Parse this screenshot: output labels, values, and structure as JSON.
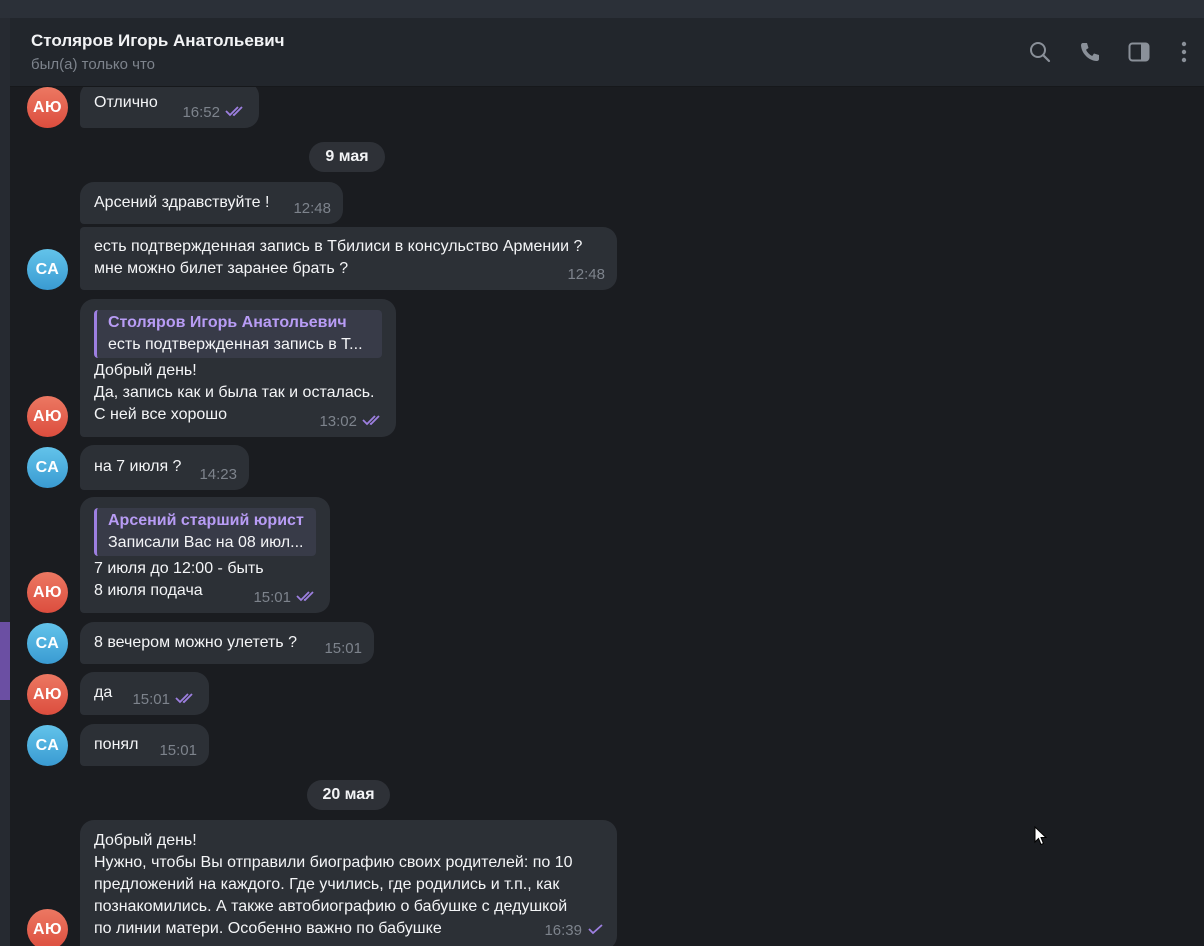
{
  "header": {
    "contact_name": "Столяров Игорь Анатольевич",
    "status": "был(а) только что",
    "icons": [
      "search-icon",
      "phone-icon",
      "sidebar-toggle-icon",
      "more-vertical-icon"
    ]
  },
  "colors": {
    "background": "#1a1c20",
    "bubble": "#2c3036",
    "accent": "#9d7fe0",
    "avatar_au": "#e5634f",
    "avatar_ca": "#4fb0e0"
  },
  "avatars": {
    "au": "АЮ",
    "ca": "СА"
  },
  "dates": {
    "may9": "9 мая",
    "may20": "20 мая"
  },
  "messages": {
    "m0": {
      "text": "Отлично",
      "time": "16:52"
    },
    "m1": {
      "text": "Арсений здравствуйте !",
      "time": "12:48"
    },
    "m2": {
      "lines": [
        "есть подтвержденная запись в Тбилиси в консульство Армении ?",
        "мне можно билет заранее брать ?"
      ],
      "time": "12:48"
    },
    "m3": {
      "reply_name": "Столяров Игорь Анатольевич",
      "reply_text": "есть подтвержденная запись в Т...",
      "lines": [
        "Добрый день!",
        "Да, запись как и была так и осталась.",
        "С ней все хорошо"
      ],
      "time": "13:02"
    },
    "m4": {
      "text": "на 7 июля ?",
      "time": "14:23"
    },
    "m5": {
      "reply_name": "Арсений старший юрист",
      "reply_text": "Записали Вас на 08 июл...",
      "lines": [
        "7 июля до 12:00 - быть",
        "8 июля подача"
      ],
      "time": "15:01"
    },
    "m6": {
      "text": "8 вечером можно улететь ?",
      "time": "15:01"
    },
    "m7": {
      "text": "да",
      "time": "15:01"
    },
    "m8": {
      "text": "понял",
      "time": "15:01"
    },
    "m9": {
      "lines": [
        "Добрый день!",
        "Нужно, чтобы Вы отправили биографию своих родителей: по 10",
        "предложений на каждого. Где учились, где родились и т.п., как",
        "познакомились. А также автобиографию о бабушке с дедушкой",
        "по линии матери. Особенно важно по бабушке"
      ],
      "time": "16:39"
    }
  }
}
